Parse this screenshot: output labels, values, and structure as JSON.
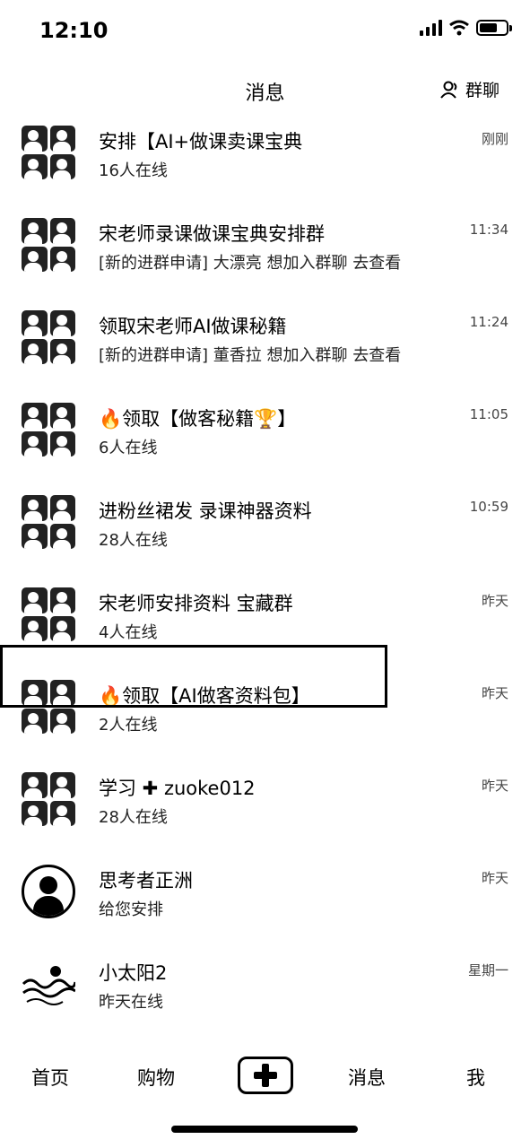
{
  "status_bar": {
    "time": "12:10"
  },
  "header": {
    "title": "消息",
    "group_chat_label": "群聊"
  },
  "conversations": [
    {
      "name": "安排【AI+做课卖课宝典",
      "sub": "16人在线",
      "time": "刚刚",
      "avatar": "group"
    },
    {
      "name": "宋老师录课做课宝典安排群",
      "sub": "[新的进群申请] 大漂亮 想加入群聊 去查看",
      "time": "11:34",
      "avatar": "group"
    },
    {
      "name": "领取宋老师AI做课秘籍",
      "sub": "[新的进群申请] 董香拉 想加入群聊 去查看",
      "time": "11:24",
      "avatar": "group"
    },
    {
      "name": "🔥领取【做客秘籍🏆】",
      "sub": "6人在线",
      "time": "11:05",
      "avatar": "group"
    },
    {
      "name": "进粉丝裙发 录课神器资料",
      "sub": "28人在线",
      "time": "10:59",
      "avatar": "group"
    },
    {
      "name": "宋老师安排资料 宝藏群",
      "sub": "4人在线",
      "time": "昨天",
      "avatar": "group"
    },
    {
      "name": "🔥领取【AI做客资料包】",
      "sub": "2人在线",
      "time": "昨天",
      "avatar": "group"
    },
    {
      "name": "学习 ✚ zuoke012",
      "sub": "28人在线",
      "time": "昨天",
      "avatar": "group"
    },
    {
      "name": "思考者正洲",
      "sub": "给您安排",
      "time": "昨天",
      "avatar": "single"
    },
    {
      "name": "小太阳2",
      "sub": "昨天在线",
      "time": "星期一",
      "avatar": "wave"
    }
  ],
  "tabbar": {
    "home": "首页",
    "shop": "购物",
    "messages": "消息",
    "me": "我"
  },
  "icons": {
    "signal": "signal-icon",
    "wifi": "wifi-icon",
    "battery": "battery-icon",
    "group_chat": "person-icon",
    "add": "plus-icon"
  }
}
